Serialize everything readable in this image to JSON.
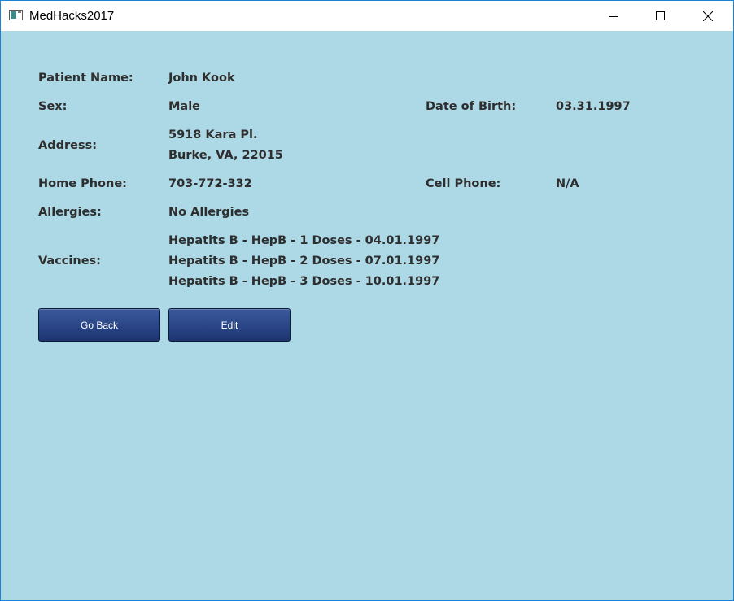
{
  "window": {
    "title": "MedHacks2017",
    "controls": {
      "minimize": "minimize-icon",
      "maximize": "maximize-icon",
      "close": "close-icon"
    }
  },
  "patient": {
    "name_label": "Patient Name:",
    "name_value": "John Kook",
    "sex_label": "Sex:",
    "sex_value": "Male",
    "dob_label": "Date of Birth:",
    "dob_value": "03.31.1997",
    "address_label": "Address:",
    "address_lines": [
      "5918 Kara Pl.",
      "Burke, VA, 22015"
    ],
    "home_phone_label": "Home Phone:",
    "home_phone_value": "703-772-332",
    "cell_phone_label": "Cell Phone:",
    "cell_phone_value": "N/A",
    "allergies_label": "Allergies:",
    "allergies_value": "No Allergies",
    "vaccines_label": "Vaccines:",
    "vaccines": [
      "Hepatits B - HepB - 1 Doses - 04.01.1997",
      "Hepatits B - HepB - 2 Doses - 07.01.1997",
      "Hepatits B - HepB - 3 Doses - 10.01.1997"
    ]
  },
  "buttons": {
    "go_back": "Go Back",
    "edit": "Edit"
  },
  "colors": {
    "background": "#add8e6",
    "text": "#2e2e2e",
    "button": "#2a4585",
    "window_border": "#1883d7"
  }
}
